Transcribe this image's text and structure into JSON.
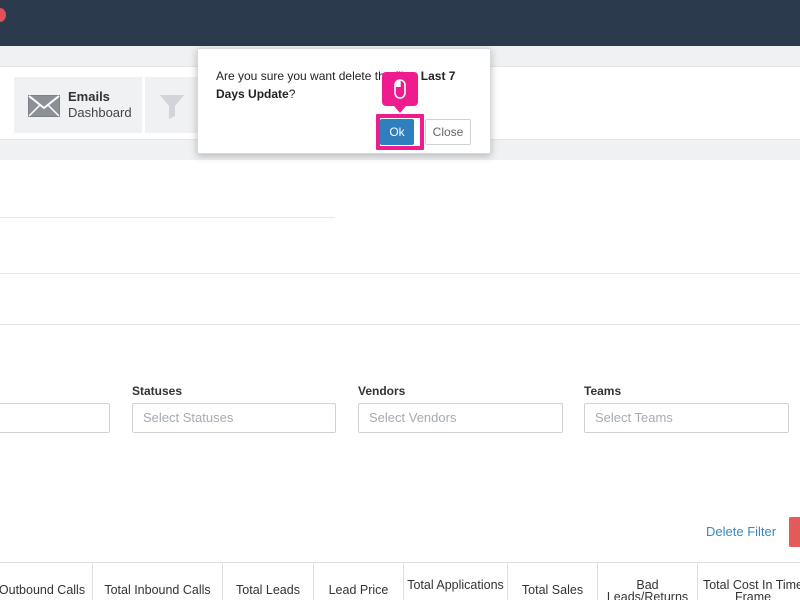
{
  "nav": {
    "emails_title": "Emails",
    "emails_sub": "Dashboard"
  },
  "filters": {
    "statuses_label": "Statuses",
    "statuses_placeholder": "Select Statuses",
    "vendors_label": "Vendors",
    "vendors_placeholder": "Select Vendors",
    "teams_label": "Teams",
    "teams_placeholder": "Select Teams"
  },
  "delete_filter_label": "Delete Filter",
  "table": {
    "columns": [
      "Outbound Calls",
      "Total Inbound Calls",
      "Total Leads",
      "Lead Price",
      "Total Applications",
      "Total Sales",
      "Bad Leads/Returns",
      "Total Cost In Time Frame"
    ]
  },
  "modal": {
    "message_prefix": "Are you sure you want delete the filter ",
    "filter_name": "Last 7 Days Update",
    "message_suffix": "?",
    "ok_label": "Ok",
    "close_label": "Close"
  },
  "icons": {
    "nav_emails": "mail-icon",
    "nav_next": "funnel-icon",
    "cursor": "mouse-icon"
  },
  "colors": {
    "topbar": "#2c3a4e",
    "primary": "#2f7fbf",
    "highlight": "#ee1c8f",
    "danger": "#e25a5a"
  }
}
